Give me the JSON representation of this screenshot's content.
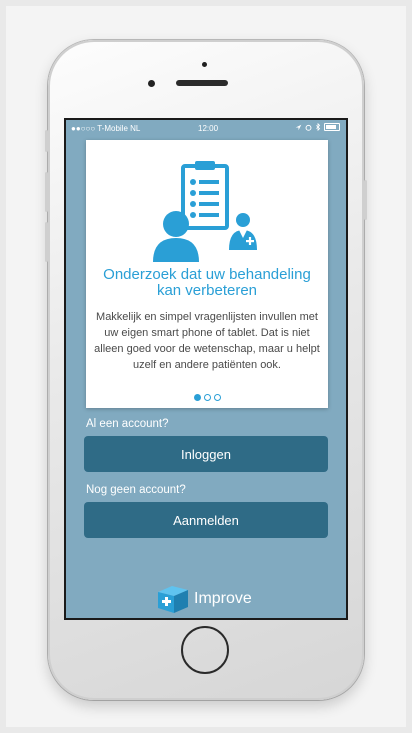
{
  "status_bar": {
    "carrier": "●●○○○ T-Mobile NL",
    "time": "12:00"
  },
  "onboarding": {
    "title": "Onderzoek dat uw behandeling kan verbeteren",
    "body": "Makkelijk en simpel vragenlijsten invullen met uw eigen smart phone of tablet. Dat is niet alleen goed voor de wetenschap, maar u helpt uzelf en andere patiënten ook.",
    "pagination": {
      "total": 3,
      "active": 1
    },
    "illustration_icon": "clipboard-doctor-patient-icon"
  },
  "login": {
    "prompt": "Al een account?",
    "button": "Inloggen"
  },
  "signup": {
    "prompt": "Nog geen account?",
    "button": "Aanmelden"
  },
  "brand": {
    "name": "Improve",
    "icon": "medical-box-icon"
  },
  "colors": {
    "screen_background": "#81aac0",
    "accent": "#2a9fd6",
    "button": "#2f6b86"
  }
}
